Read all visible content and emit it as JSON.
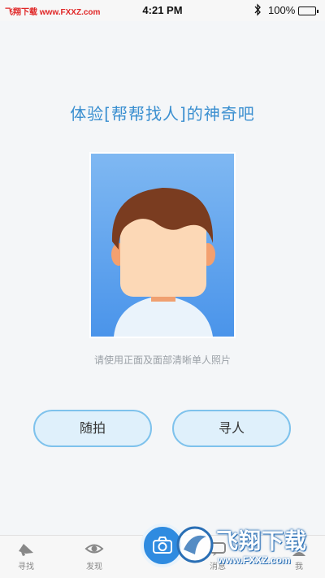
{
  "status_bar": {
    "watermark": "飞翔下载 www.FXXZ.com",
    "time": "4:21 PM",
    "battery_percent": "100%",
    "bluetooth_icon": "bluetooth-icon",
    "battery_icon": "battery-icon"
  },
  "main": {
    "headline": "体验[帮帮找人]的神奇吧",
    "photo_hint": "请使用正面及面部清晰单人照片",
    "buttons": {
      "random_shot": "随拍",
      "find_person": "寻人"
    }
  },
  "tab_bar": {
    "tabs": [
      {
        "label": "寻找",
        "icon": "megaphone-icon"
      },
      {
        "label": "发现",
        "icon": "eye-icon"
      },
      {
        "label": "消息",
        "icon": "message-icon"
      },
      {
        "label": "我",
        "icon": "person-icon"
      }
    ],
    "center_button_icon": "camera-icon"
  },
  "watermark_logo": {
    "title": "飞翔下载",
    "url": "www.FXXZ.com"
  },
  "colors": {
    "accent": "#3a8fd0",
    "button_border": "#7ec2ec",
    "button_fill": "#dff0fb",
    "hint_text": "#9aa0a6",
    "fab": "#2f8be0"
  }
}
